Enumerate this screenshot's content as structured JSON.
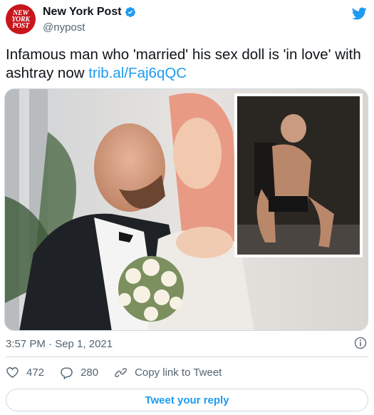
{
  "account": {
    "avatar_text_line1": "NEW",
    "avatar_text_line2": "YORK",
    "avatar_text_line3": "POST",
    "name": "New York Post",
    "handle": "@nypost",
    "verified": true
  },
  "tweet": {
    "text": "Infamous man who 'married' his sex doll is 'in love' with ashtray now ",
    "link": "trib.al/Faj6qQC",
    "timestamp": "3:57 PM · Sep 1, 2021"
  },
  "actions": {
    "likes": "472",
    "replies": "280",
    "copy_link": "Copy link to Tweet"
  },
  "reply_button": "Tweet your reply",
  "colors": {
    "accent": "#1d9bf0",
    "brand_red": "#c8161d",
    "muted": "#536471"
  },
  "icons": [
    "twitter-bird-icon",
    "verified-badge-icon",
    "info-icon",
    "heart-icon",
    "reply-icon",
    "link-icon"
  ]
}
